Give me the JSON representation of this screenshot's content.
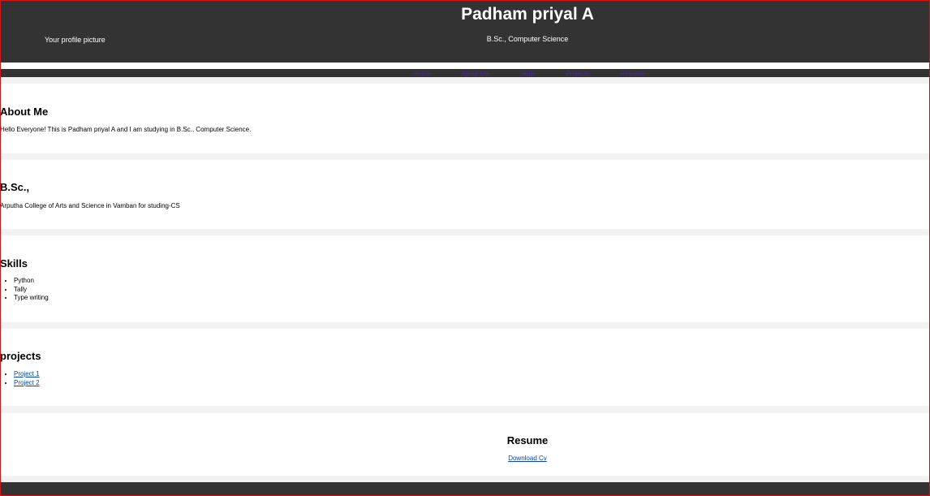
{
  "header": {
    "profile_picture_alt": "Your profile picture",
    "name": "Padham priyal A",
    "degree": "B.Sc., Computer Science"
  },
  "nav": {
    "items": [
      "Home",
      "About Me",
      "Skills",
      "Projects",
      "Resume"
    ]
  },
  "about": {
    "heading": "About Me",
    "text": "Hello Everyone! This is Padham priyal A and I am studying in B.Sc., Computer Science."
  },
  "education": {
    "heading": "B.Sc.,",
    "text": "Arputha College of Arts and Science in Vamban for studing-CS"
  },
  "skills": {
    "heading": "Skills",
    "items": [
      "Python",
      "Tally",
      "Type writing"
    ]
  },
  "projects": {
    "heading": "projects",
    "items": [
      "Project 1",
      "Project 2"
    ]
  },
  "resume": {
    "heading": "Resume",
    "download_label": "Download Cv"
  },
  "colors": {
    "header_bg": "#333333",
    "page_bg": "#f2f2f2",
    "link": "#0645ad",
    "window_border": "#dd1111"
  }
}
